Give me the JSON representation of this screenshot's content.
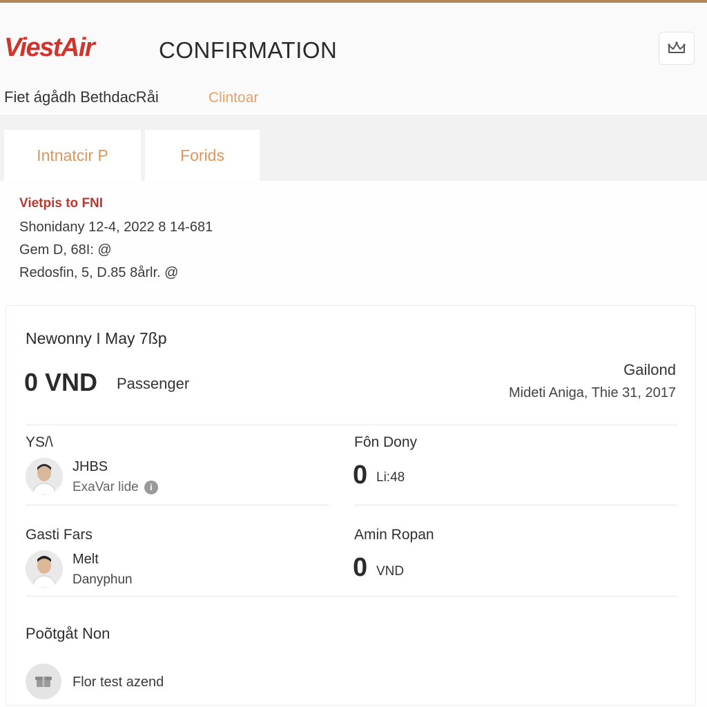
{
  "header": {
    "logo_text": "ViestAir",
    "page_title": "CONFIRMATION",
    "subtitle": "Fiet ágådh BethdacRåi",
    "sub_link": "Clintoar",
    "corner_icon": "crown-icon"
  },
  "tabs": [
    {
      "label": "Intnatcir P"
    },
    {
      "label": "Forids"
    }
  ],
  "route": {
    "title": "Vietpis to FNI",
    "lines": [
      "Shonidany 12-4, 2022 8 14-681",
      "Gem D, 68I: @",
      "Redosfin, 5, D.85 8årlr. @"
    ]
  },
  "card": {
    "heading": "Newonny I May 7ßp",
    "price_value": "0 VND",
    "price_tag": "Passenger",
    "right_title": "Gailond",
    "right_sub": "Mideti Aniga, Thie 31, 2017",
    "left_section_1": {
      "label": "YS/\\",
      "name": "JHBS",
      "sub": "ExaVar lide"
    },
    "right_section_1": {
      "label": "Fôn Dony",
      "amount": "0",
      "unit": "Li:48"
    },
    "left_section_2": {
      "label": "Gasti Fars",
      "name": "Melt",
      "sub": "Danyphun"
    },
    "right_section_2": {
      "label": "Amin Ropan",
      "amount": "0",
      "unit": "VND"
    },
    "footer_heading": "Poõtgåt Non",
    "footer_text": "Flor test azend"
  },
  "colors": {
    "brand_red": "#d0342c",
    "tab_orange": "#e0945a",
    "link_orange": "#e6a266",
    "route_red": "#b43a32",
    "top_line": "#b5855a"
  }
}
